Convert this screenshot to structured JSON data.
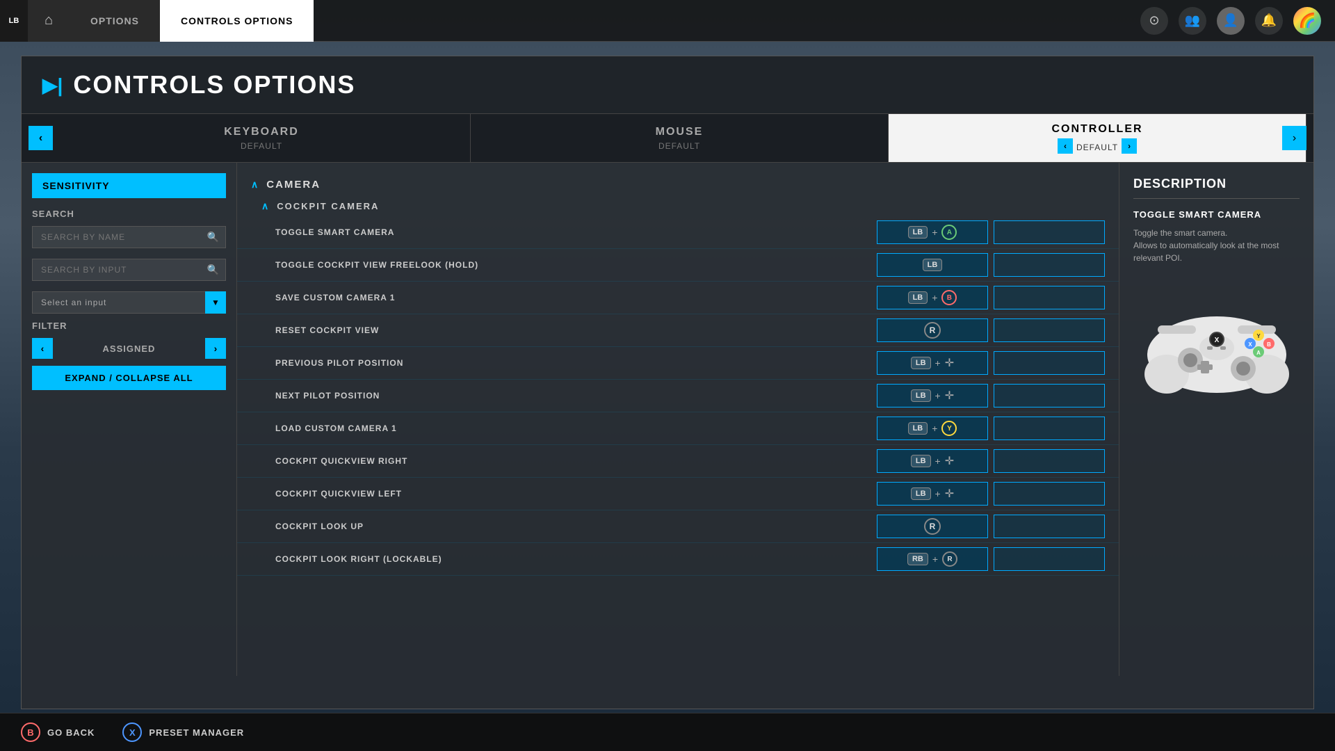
{
  "topNav": {
    "lbLabel": "LB",
    "homeIcon": "⌂",
    "optionsTab": "OPTIONS",
    "controlsTab": "CONTROLS OPTIONS",
    "navIcons": [
      {
        "name": "target-icon",
        "symbol": "⊙"
      },
      {
        "name": "people-icon",
        "symbol": "👥"
      },
      {
        "name": "person-icon",
        "symbol": "👤"
      },
      {
        "name": "bell-icon",
        "symbol": "🔔"
      }
    ]
  },
  "pageHeader": {
    "icon": "▶|",
    "title": "CONTROLS OPTIONS"
  },
  "tabs": [
    {
      "label": "KEYBOARD",
      "sublabel": "DEFAULT",
      "active": false
    },
    {
      "label": "MOUSE",
      "sublabel": "DEFAULT",
      "active": false
    },
    {
      "label": "CONTROLLER",
      "sublabel": "DEFAULT",
      "active": true
    }
  ],
  "sidebar": {
    "sensitivityLabel": "SENSITIVITY",
    "searchLabel": "SEARCH",
    "searchByNamePlaceholder": "SEARCH BY NAME",
    "searchByInputPlaceholder": "SEARCH BY INPUT",
    "selectInputPlaceholder": "Select an input",
    "filterLabel": "FILTER",
    "filterValue": "ASSIGNED",
    "expandCollapseLabel": "EXPAND / COLLAPSE ALL"
  },
  "description": {
    "title": "DESCRIPTION",
    "subtitle": "TOGGLE SMART CAMERA",
    "text": "Toggle the smart camera.\nAllows to automatically look at the most\nrelevant POI."
  },
  "camera": {
    "sectionLabel": "CAMERA",
    "subsections": [
      {
        "label": "COCKPIT CAMERA",
        "controls": [
          {
            "name": "TOGGLE SMART CAMERA",
            "binding1": {
              "type": "combo",
              "btn1": "LB",
              "btn2": "A",
              "btn2type": "circle",
              "btn2color": "green"
            },
            "binding2": ""
          },
          {
            "name": "TOGGLE COCKPIT VIEW FREELOOK (HOLD)",
            "binding1": {
              "type": "single",
              "btn1": "LB"
            },
            "binding2": ""
          },
          {
            "name": "SAVE CUSTOM CAMERA 1",
            "binding1": {
              "type": "combo",
              "btn1": "LB",
              "btn2": "B",
              "btn2type": "circle",
              "btn2color": "red"
            },
            "binding2": ""
          },
          {
            "name": "RESET COCKPIT VIEW",
            "binding1": {
              "type": "single-circle",
              "btn1": "R",
              "btncolor": ""
            },
            "binding2": ""
          },
          {
            "name": "PREVIOUS PILOT POSITION",
            "binding1": {
              "type": "combo-dpad",
              "btn1": "LB"
            },
            "binding2": ""
          },
          {
            "name": "NEXT PILOT POSITION",
            "binding1": {
              "type": "combo-dpad",
              "btn1": "LB"
            },
            "binding2": ""
          },
          {
            "name": "LOAD CUSTOM CAMERA 1",
            "binding1": {
              "type": "combo",
              "btn1": "LB",
              "btn2": "Y",
              "btn2type": "circle",
              "btn2color": "yellow"
            },
            "binding2": ""
          },
          {
            "name": "COCKPIT QUICKVIEW RIGHT",
            "binding1": {
              "type": "combo-dpad",
              "btn1": "LB"
            },
            "binding2": ""
          },
          {
            "name": "COCKPIT QUICKVIEW LEFT",
            "binding1": {
              "type": "combo-dpad",
              "btn1": "LB"
            },
            "binding2": ""
          },
          {
            "name": "COCKPIT LOOK UP",
            "binding1": {
              "type": "single-circle",
              "btn1": "R",
              "btncolor": ""
            },
            "binding2": ""
          },
          {
            "name": "COCKPIT LOOK RIGHT (LOCKABLE)",
            "binding1": {
              "type": "combo-rb",
              "btn1": "RB",
              "btn2": "R"
            },
            "binding2": ""
          }
        ]
      }
    ]
  },
  "bottomBar": {
    "goBack": {
      "btnLabel": "B",
      "label": "GO BACK"
    },
    "presetManager": {
      "btnLabel": "X",
      "label": "PRESET MANAGER"
    }
  }
}
